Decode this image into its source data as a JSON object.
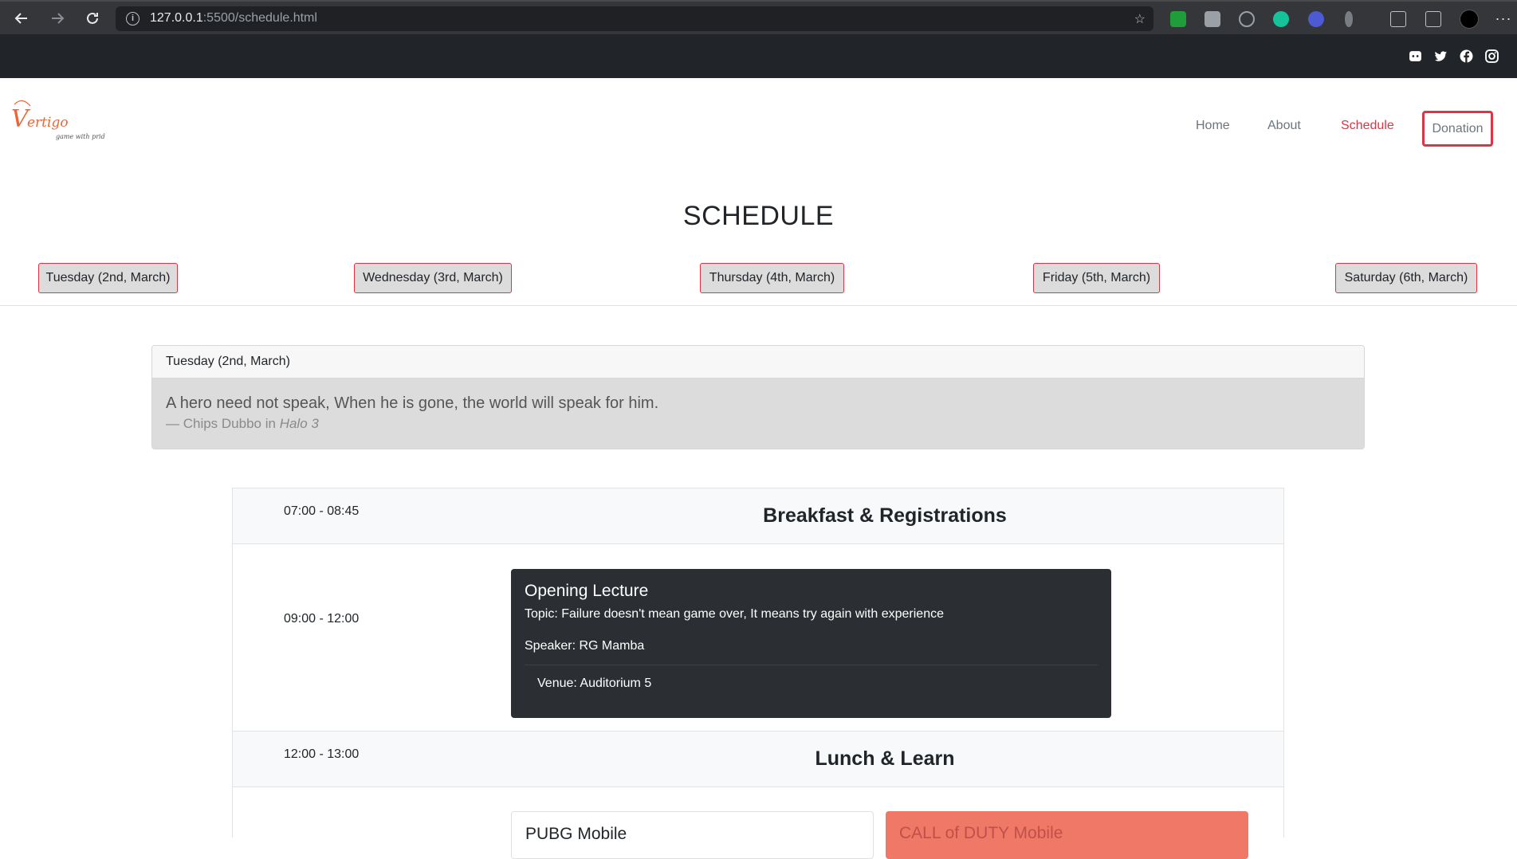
{
  "browser": {
    "url_host": "127.0.0.1",
    "url_path": ":5500/schedule.html"
  },
  "header": {
    "logo_text": "Vertigo",
    "logo_tagline": "game with pride",
    "nav": [
      "Home",
      "About",
      "Schedule"
    ],
    "active_nav": "Schedule",
    "donation_label": "Donation"
  },
  "page": {
    "title": "SCHEDULE",
    "days": [
      "Tuesday (2nd, March)",
      "Wednesday (3rd, March)",
      "Thursday (4th, March)",
      "Friday (5th, March)",
      "Saturday (6th, March)"
    ]
  },
  "quote": {
    "header": "Tuesday (2nd, March)",
    "text": "A hero need not speak, When he is gone, the world will speak for him.",
    "source_prefix": "— Chips Dubbo in ",
    "source_work": "Halo 3"
  },
  "schedule": {
    "rows": [
      {
        "time": "07:00 - 08:45",
        "title": "Breakfast & Registrations"
      },
      {
        "time": "09:00 - 12:00"
      },
      {
        "time": "12:00 - 13:00",
        "title": "Lunch & Learn"
      }
    ],
    "event": {
      "title": "Opening Lecture",
      "topic": "Topic: Failure doesn't mean game over, It means try again with experience",
      "speaker": "Speaker: RG Mamba",
      "venue": "Venue: Auditorium 5"
    },
    "games": [
      "PUBG Mobile",
      "CALL of DUTY Mobile"
    ]
  },
  "colors": {
    "accent": "#dc3545",
    "dark": "#212529",
    "event_card": "#2b2f33",
    "highlight_card": "#f07867"
  }
}
